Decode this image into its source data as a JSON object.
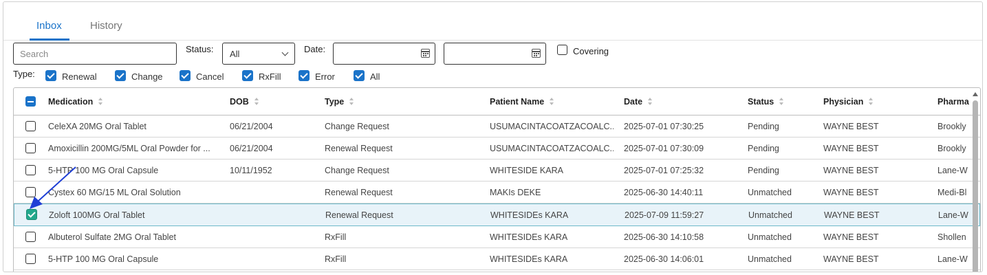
{
  "tabs": [
    {
      "label": "Inbox",
      "active": true
    },
    {
      "label": "History",
      "active": false
    }
  ],
  "filters": {
    "search_placeholder": "Search",
    "status_label": "Status:",
    "status_value": "All",
    "date_label": "Date:",
    "covering_label": "Covering",
    "type_label": "Type:",
    "types": [
      "Renewal",
      "Change",
      "Cancel",
      "RxFill",
      "Error",
      "All"
    ]
  },
  "columns": [
    "Medication",
    "DOB",
    "Type",
    "Patient Name",
    "Date",
    "Status",
    "Physician",
    "Pharma"
  ],
  "rows": [
    {
      "medication": "CeleXA 20MG Oral Tablet",
      "dob": "06/21/2004",
      "type": "Change Request",
      "patient": "USUMACINTACOATZACOALC...",
      "date": "2025-07-01 07:30:25",
      "status": "Pending",
      "physician": "WAYNE BEST",
      "pharmacy": "Brookly",
      "checked": false
    },
    {
      "medication": "Amoxicillin 200MG/5ML Oral Powder for ...",
      "dob": "06/21/2004",
      "type": "Renewal Request",
      "patient": "USUMACINTACOATZACOALC...",
      "date": "2025-07-01 07:30:09",
      "status": "Pending",
      "physician": "WAYNE BEST",
      "pharmacy": "Brookly",
      "checked": false
    },
    {
      "medication": "5-HTP 100 MG Oral Capsule",
      "dob": "10/11/1952",
      "type": "Change Request",
      "patient": "WHITESIDE KARA",
      "date": "2025-07-01 07:25:32",
      "status": "Pending",
      "physician": "WAYNE BEST",
      "pharmacy": "Lane-W",
      "checked": false
    },
    {
      "medication": "Cystex 60 MG/15 ML Oral Solution",
      "dob": "",
      "type": "Renewal Request",
      "patient": "MAKIs DEKE",
      "date": "2025-06-30 14:40:11",
      "status": "Unmatched",
      "physician": "WAYNE BEST",
      "pharmacy": "Medi-Bl",
      "checked": false
    },
    {
      "medication": "Zoloft 100MG Oral Tablet",
      "dob": "",
      "type": "Renewal Request",
      "patient": "WHITESIDEs KARA",
      "date": "2025-07-09 11:59:27",
      "status": "Unmatched",
      "physician": "WAYNE BEST",
      "pharmacy": "Lane-W",
      "checked": true
    },
    {
      "medication": "Albuterol Sulfate 2MG Oral Tablet",
      "dob": "",
      "type": "RxFill",
      "patient": "WHITESIDEs KARA",
      "date": "2025-06-30 14:10:58",
      "status": "Unmatched",
      "physician": "WAYNE BEST",
      "pharmacy": "Shollen",
      "checked": false
    },
    {
      "medication": "5-HTP 100 MG Oral Capsule",
      "dob": "",
      "type": "RxFill",
      "patient": "WHITESIDEs KARA",
      "date": "2025-06-30 14:06:01",
      "status": "Unmatched",
      "physician": "WAYNE BEST",
      "pharmacy": "Lane-W",
      "checked": false
    }
  ],
  "colors": {
    "accent": "#1a73c9",
    "selected_check": "#23a88c",
    "annotation_arrow": "#1f3fd6"
  }
}
